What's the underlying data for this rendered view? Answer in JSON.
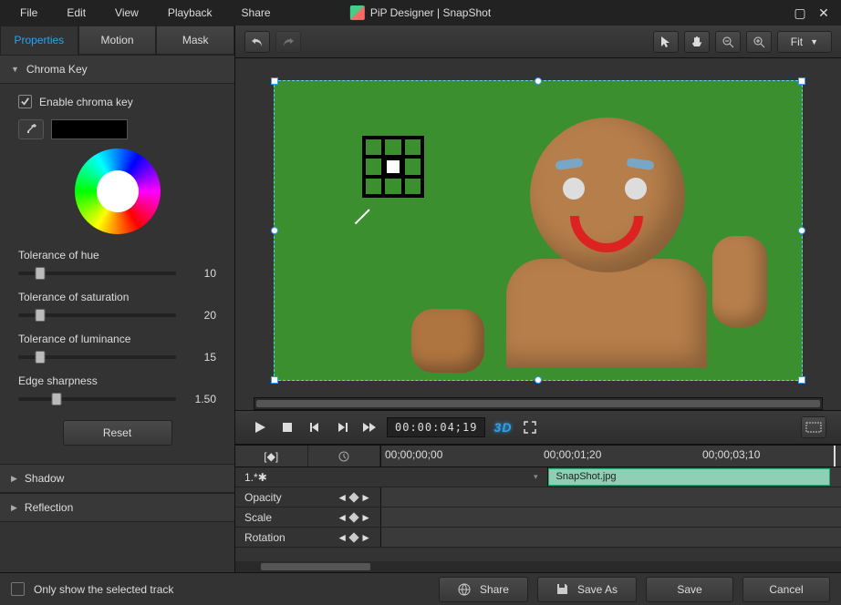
{
  "menu": {
    "items": [
      "File",
      "Edit",
      "View",
      "Playback",
      "Share"
    ]
  },
  "window": {
    "title": "PiP Designer | SnapShot"
  },
  "tabs": {
    "properties": "Properties",
    "motion": "Motion",
    "mask": "Mask"
  },
  "chroma": {
    "section": "Chroma Key",
    "enable": "Enable chroma key",
    "swatch_color": "#000000",
    "sliders": [
      {
        "label": "Tolerance of hue",
        "value": "10",
        "pos": 14
      },
      {
        "label": "Tolerance of saturation",
        "value": "20",
        "pos": 14
      },
      {
        "label": "Tolerance of luminance",
        "value": "15",
        "pos": 14
      },
      {
        "label": "Edge sharpness",
        "value": "1.50",
        "pos": 24
      }
    ],
    "reset": "Reset"
  },
  "sections": {
    "shadow": "Shadow",
    "reflection": "Reflection"
  },
  "preview": {
    "fit": "Fit"
  },
  "playback": {
    "timecode": "00:00:04;19",
    "threeD": "3D"
  },
  "timeline": {
    "ticks": [
      "00;00;00;00",
      "00;00;01;20",
      "00;00;03;10"
    ],
    "track_label": "1.*",
    "clip": "SnapShot.jpg",
    "props": [
      "Opacity",
      "Scale",
      "Rotation"
    ]
  },
  "footer": {
    "only_show": "Only show the selected track",
    "share": "Share",
    "save_as": "Save As",
    "save": "Save",
    "cancel": "Cancel"
  }
}
